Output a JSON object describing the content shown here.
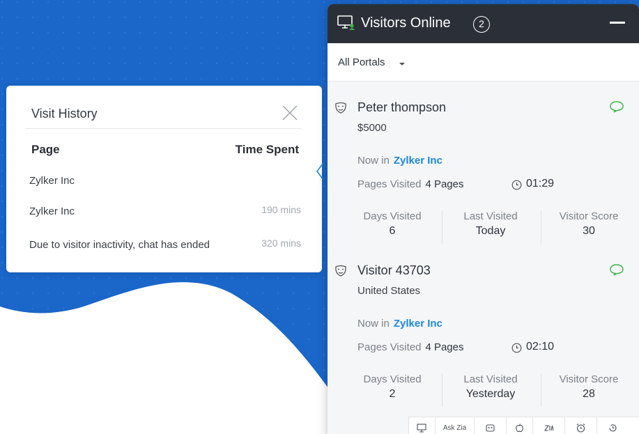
{
  "visit_history": {
    "title": "Visit History",
    "col_page": "Page",
    "col_time": "Time Spent",
    "rows": [
      {
        "page": "Zylker Inc",
        "time": ""
      },
      {
        "page": "Zylker Inc",
        "time": "190 mins"
      },
      {
        "page": "Due to visitor inactivity, chat has ended",
        "time": "320 mins"
      }
    ]
  },
  "visitors_online": {
    "title": "Visitors Online",
    "count": "2",
    "portal_filter": "All Portals",
    "visitors": [
      {
        "name": "Peter thompson",
        "sub": "$5000",
        "now_in_label": "Now in",
        "now_in_value": "Zylker Inc",
        "pages_label": "Pages Visited",
        "pages_value": "4 Pages",
        "time": "01:29",
        "stats": [
          {
            "label": "Days Visited",
            "value": "6"
          },
          {
            "label": "Last Visited",
            "value": "Today"
          },
          {
            "label": "Visitor Score",
            "value": "30"
          }
        ]
      },
      {
        "name": "Visitor 43703",
        "sub": "United States",
        "now_in_label": "Now in",
        "now_in_value": "Zylker Inc",
        "pages_label": "Pages Visited",
        "pages_value": "4 Pages",
        "time": "02:10",
        "stats": [
          {
            "label": "Days Visited",
            "value": "2"
          },
          {
            "label": "Last Visited",
            "value": "Yesterday"
          },
          {
            "label": "Visitor Score",
            "value": "28"
          }
        ]
      }
    ],
    "footer": {
      "ask_zia": "Ask Zia",
      "icons": [
        "monitor-icon",
        "bot-icon",
        "apple-icon",
        "zia-icon",
        "alarm-icon",
        "history-icon"
      ]
    }
  },
  "colors": {
    "background_blue": "#1a66c9",
    "header_dark": "#2b3038",
    "link_blue": "#1e88d6",
    "chat_green": "#3fb64a"
  }
}
